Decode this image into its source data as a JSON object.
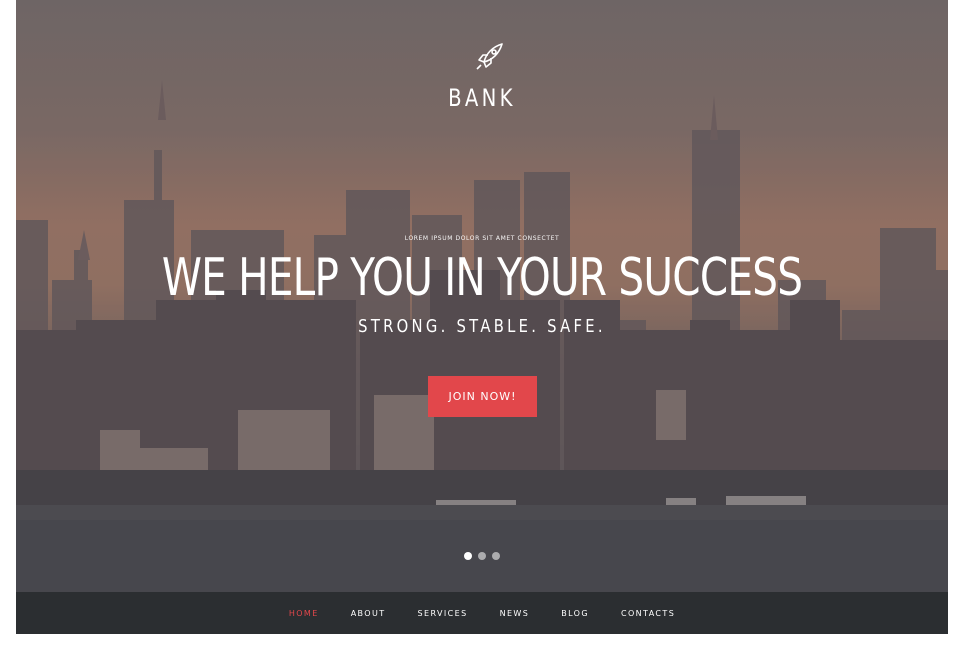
{
  "brand": {
    "name": "BANK",
    "logo_icon": "rocket-icon"
  },
  "hero": {
    "tagline": "LOREM IPSUM DOLOR SIT AMET CONSECTET",
    "headline": "WE HELP YOU IN YOUR SUCCESS",
    "subheadline": "STRONG. STABLE. SAFE.",
    "cta_label": "JOIN NOW!",
    "slides": [
      {
        "active": true
      },
      {
        "active": false
      },
      {
        "active": false
      }
    ]
  },
  "nav": {
    "items": [
      {
        "label": "HOME",
        "active": true
      },
      {
        "label": "ABOUT",
        "active": false
      },
      {
        "label": "SERVICES",
        "active": false
      },
      {
        "label": "NEWS",
        "active": false
      },
      {
        "label": "BLOG",
        "active": false
      },
      {
        "label": "CONTACTS",
        "active": false
      }
    ]
  },
  "colors": {
    "accent": "#e2474b",
    "navbar_bg": "#2b2e31",
    "text": "#ffffff"
  }
}
